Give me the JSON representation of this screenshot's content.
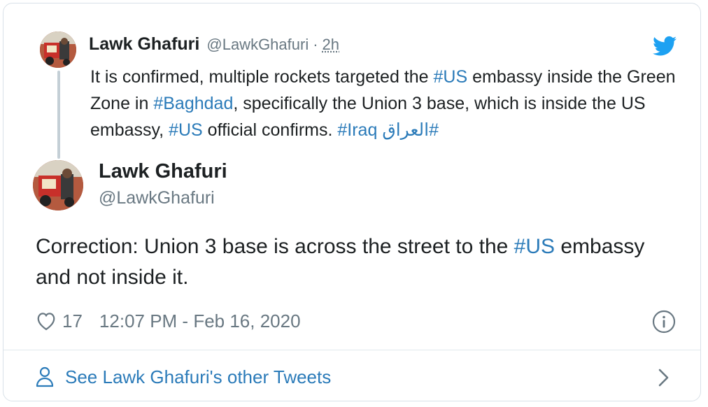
{
  "quoted": {
    "name": "Lawk Ghafuri",
    "handle": "@LawkGhafuri",
    "separator": "·",
    "time": "2h",
    "text_parts": {
      "p1": "It is confirmed, multiple rockets targeted the ",
      "h1": "#US",
      "p2": " embassy inside the Green Zone in ",
      "h2": "#Baghdad",
      "p3": ", specifically the Union 3 base, which is inside the US embassy, ",
      "h3": "#US",
      "p4": " official confirms. ",
      "h4": "#Iraq",
      "p5": " ",
      "h5": "#العراق"
    }
  },
  "tweet": {
    "name": "Lawk Ghafuri",
    "handle": "@LawkGhafuri",
    "text_parts": {
      "p1": "Correction: Union 3 base is across the street to the ",
      "h1": "#US",
      "p2": " embassy and not inside it."
    },
    "likes": "17",
    "timestamp": "12:07 PM - Feb 16, 2020"
  },
  "footer": {
    "link_label": "See Lawk Ghafuri's other Tweets"
  },
  "colors": {
    "link": "#2b7bb9",
    "muted": "#697882",
    "twitter_blue": "#1da1f2",
    "border": "#d9e1e8"
  },
  "icons": [
    "twitter-bird-icon",
    "heart-icon",
    "info-icon",
    "person-icon",
    "chevron-right-icon"
  ]
}
